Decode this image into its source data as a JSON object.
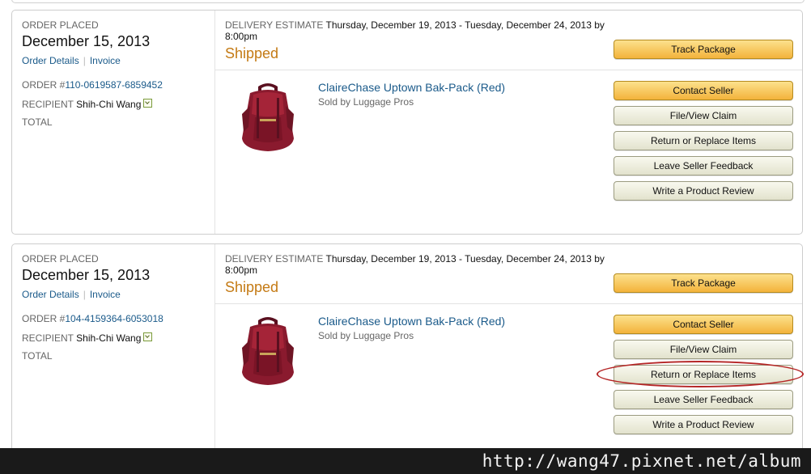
{
  "orders": [
    {
      "placed_label": "ORDER PLACED",
      "placed_date": "December 15, 2013",
      "order_details_link": "Order Details",
      "invoice_link": "Invoice",
      "order_number_label": "ORDER #",
      "order_number": "110-0619587-6859452",
      "recipient_label": "RECIPIENT",
      "recipient_name": "Shih-Chi Wang",
      "total_label": "TOTAL",
      "delivery_label": "DELIVERY ESTIMATE",
      "delivery_value": "Thursday, December 19, 2013 - Tuesday, December 24, 2013 by 8:00pm",
      "status": "Shipped",
      "product_title": "ClaireChase Uptown Bak-Pack (Red)",
      "sold_by": "Sold by Luggage Pros",
      "buttons": {
        "track": "Track Package",
        "contact": "Contact Seller",
        "claim": "File/View Claim",
        "return": "Return or Replace Items",
        "feedback": "Leave Seller Feedback",
        "review": "Write a Product Review"
      }
    },
    {
      "placed_label": "ORDER PLACED",
      "placed_date": "December 15, 2013",
      "order_details_link": "Order Details",
      "invoice_link": "Invoice",
      "order_number_label": "ORDER #",
      "order_number": "104-4159364-6053018",
      "recipient_label": "RECIPIENT",
      "recipient_name": "Shih-Chi Wang",
      "total_label": "TOTAL",
      "delivery_label": "DELIVERY ESTIMATE",
      "delivery_value": "Thursday, December 19, 2013 - Tuesday, December 24, 2013 by 8:00pm",
      "status": "Shipped",
      "product_title": "ClaireChase Uptown Bak-Pack (Red)",
      "sold_by": "Sold by Luggage Pros",
      "buttons": {
        "track": "Track Package",
        "contact": "Contact Seller",
        "claim": "File/View Claim",
        "return": "Return or Replace Items",
        "feedback": "Leave Seller Feedback",
        "review": "Write a Product Review"
      }
    }
  ],
  "watermark": "http://wang47.pixnet.net/album",
  "colors": {
    "link": "#1a5a8a",
    "status_shipped": "#c47a14",
    "button_yellow": "#f3b33b",
    "button_grey": "#e2e2cd",
    "annotation_ring": "#b52626"
  },
  "icons": {
    "recipient_dropdown": "chevron-down-icon",
    "product_image": "backpack-product-image"
  },
  "annotation": "red ellipse around Return or Replace Items (second order)"
}
